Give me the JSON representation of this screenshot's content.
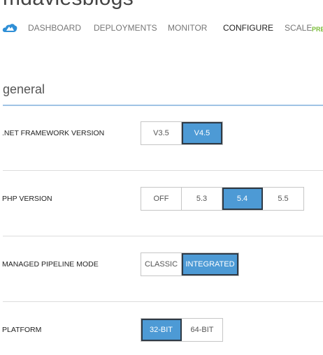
{
  "header": {
    "site_name": "mdaviesblogs"
  },
  "nav": {
    "logo_icon": "azure-cloud-icon",
    "tabs": [
      {
        "label": "DASHBOARD"
      },
      {
        "label": "DEPLOYMENTS"
      },
      {
        "label": "MONITOR"
      },
      {
        "label": "CONFIGURE",
        "active": true
      },
      {
        "label": "SCALE"
      }
    ],
    "preview_badge": "PRE"
  },
  "section": {
    "heading": "general"
  },
  "settings": {
    "net_framework": {
      "label": ".NET FRAMEWORK VERSION",
      "options": [
        "V3.5",
        "V4.5"
      ],
      "selected": "V4.5"
    },
    "php_version": {
      "label": "PHP VERSION",
      "options": [
        "OFF",
        "5.3",
        "5.4",
        "5.5"
      ],
      "selected": "5.4"
    },
    "pipeline_mode": {
      "label": "MANAGED PIPELINE MODE",
      "options": [
        "CLASSIC",
        "INTEGRATED"
      ],
      "selected": "INTEGRATED"
    },
    "platform": {
      "label": "PLATFORM",
      "options": [
        "32-BIT",
        "64-BIT"
      ],
      "selected": "32-BIT"
    }
  },
  "colors": {
    "accent": "#4d9ad5",
    "selected_border": "#2e3a46",
    "preview_green": "#7bbd3a"
  }
}
